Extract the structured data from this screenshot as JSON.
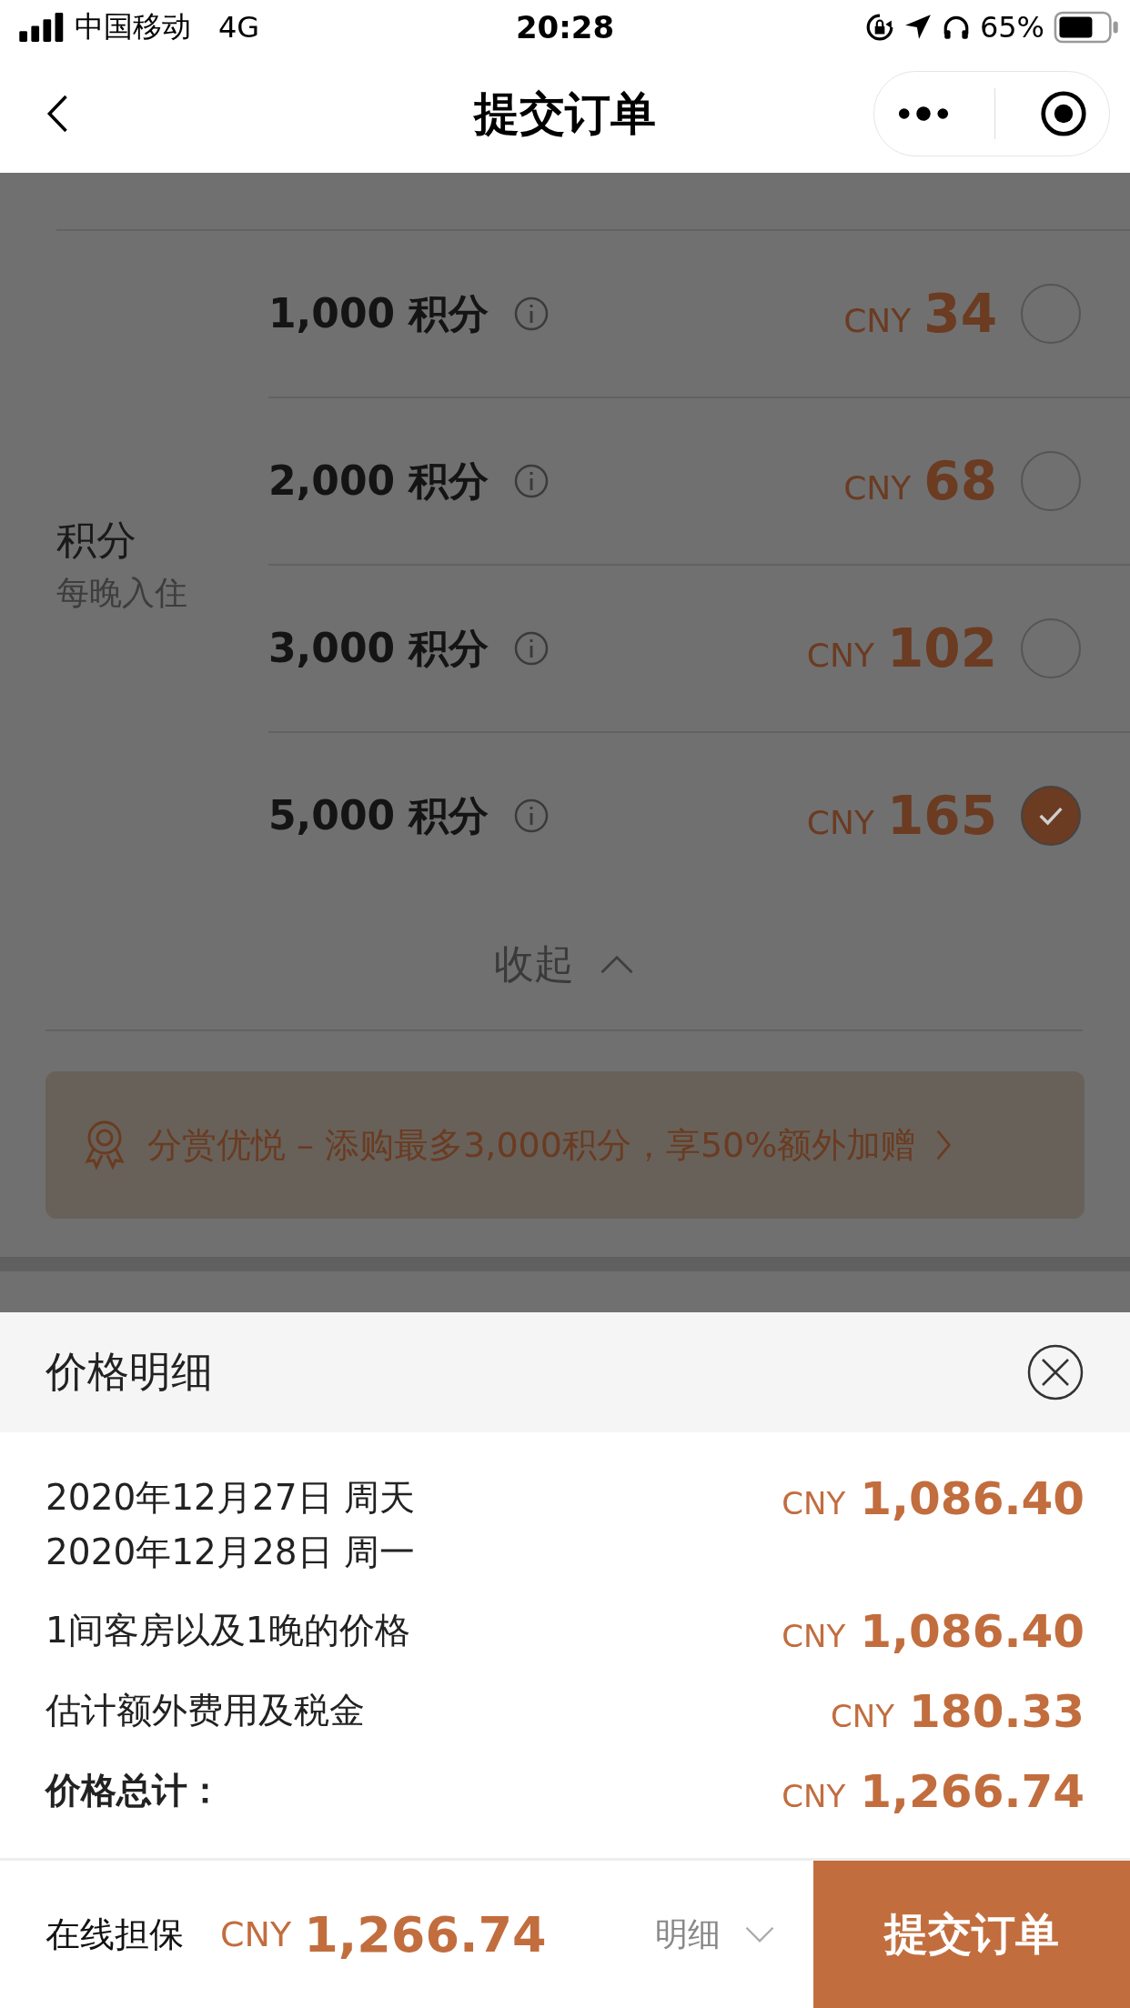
{
  "status_bar": {
    "carrier": "中国移动",
    "network": "4G",
    "time": "20:28",
    "battery": "65%"
  },
  "nav": {
    "title": "提交订单"
  },
  "points": {
    "title": "积分",
    "subtitle": "每晚入住",
    "options": [
      {
        "label": "1,000 积分",
        "currency": "CNY",
        "price": "34",
        "selected": false
      },
      {
        "label": "2,000 积分",
        "currency": "CNY",
        "price": "68",
        "selected": false
      },
      {
        "label": "3,000 积分",
        "currency": "CNY",
        "price": "102",
        "selected": false
      },
      {
        "label": "5,000 积分",
        "currency": "CNY",
        "price": "165",
        "selected": true
      }
    ],
    "collapse": "收起"
  },
  "promo": {
    "text": "分赏优悦 – 添购最多3,000积分，享50%额外加赠"
  },
  "price_sheet": {
    "title": "价格明细",
    "rows": [
      {
        "lines": [
          "2020年12月27日 周天",
          "2020年12月28日 周一"
        ],
        "currency": "CNY",
        "amount": "1,086.40",
        "bold": false
      },
      {
        "lines": [
          "1间客房以及1晚的价格"
        ],
        "currency": "CNY",
        "amount": "1,086.40",
        "bold": false
      },
      {
        "lines": [
          "估计额外费用及税金"
        ],
        "currency": "CNY",
        "amount": "180.33",
        "bold": false
      },
      {
        "lines": [
          "价格总计："
        ],
        "currency": "CNY",
        "amount": "1,266.74",
        "bold": true
      }
    ]
  },
  "bottom_bar": {
    "label": "在线担保",
    "currency": "CNY",
    "amount": "1,266.74",
    "details": "明细",
    "submit": "提交订单"
  }
}
